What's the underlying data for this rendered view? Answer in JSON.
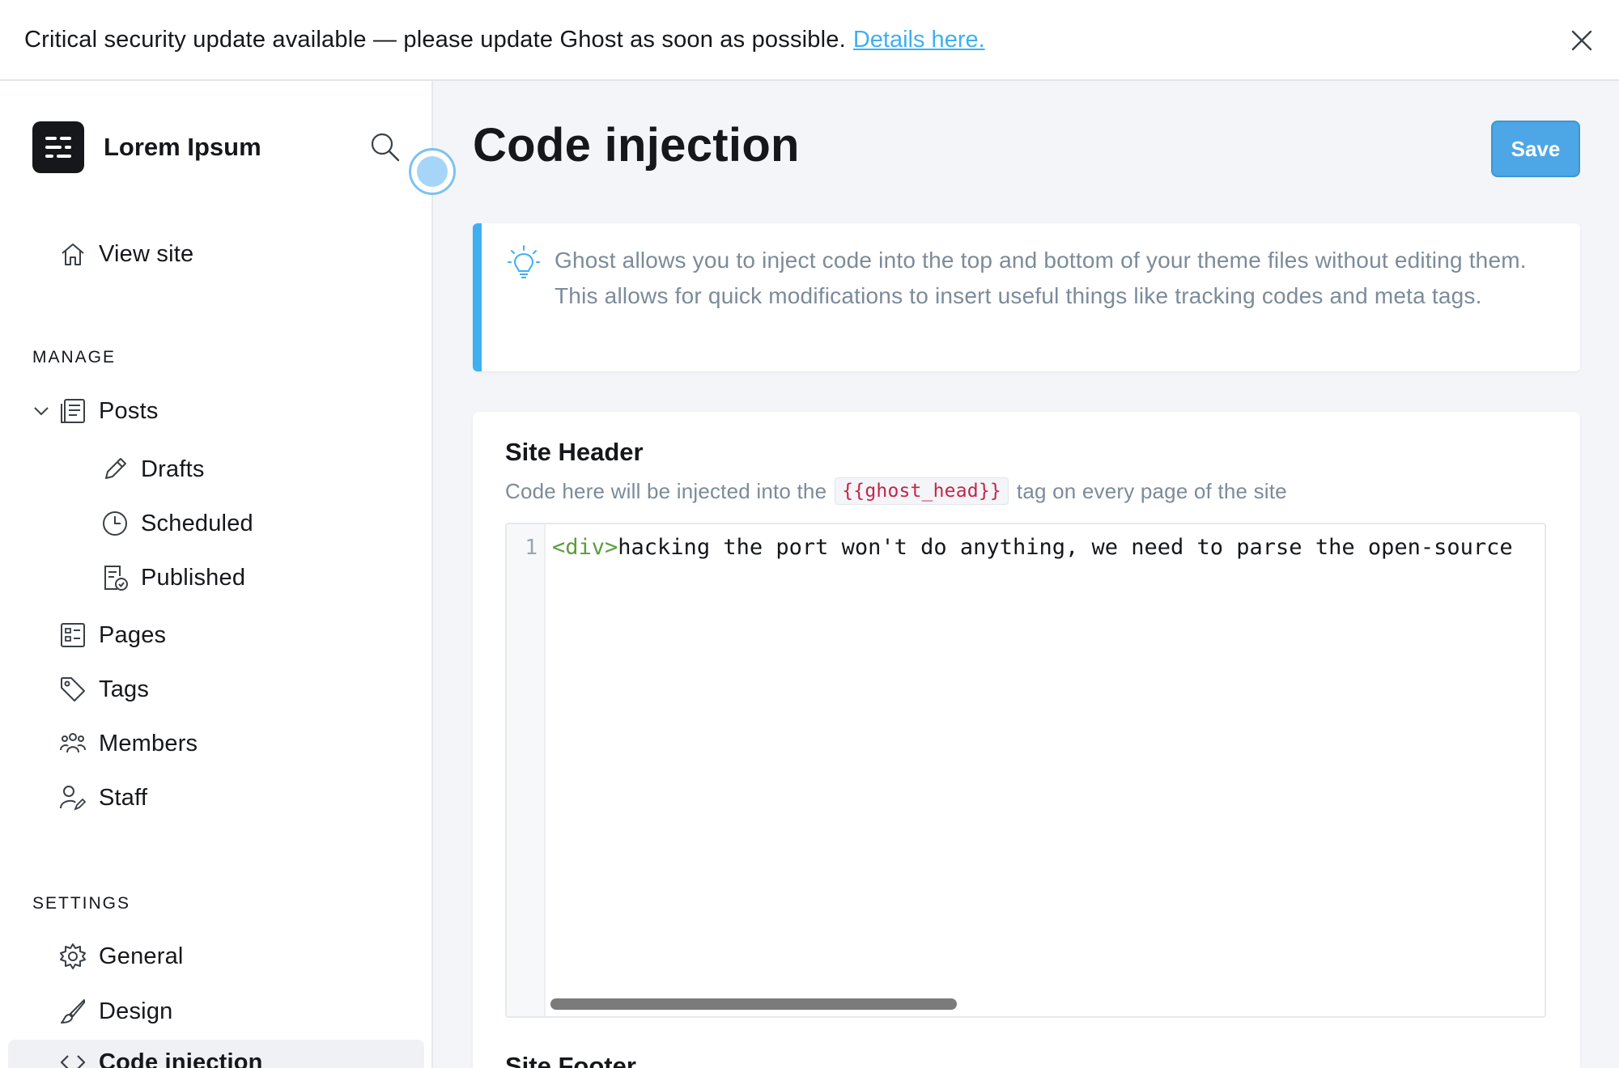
{
  "banner": {
    "message": "Critical security update available — please update Ghost as soon as possible.",
    "link_text": "Details here."
  },
  "sidebar": {
    "brand": "Lorem Ipsum",
    "view_site": "View site",
    "manage_label": "MANAGE",
    "manage_items": {
      "posts": "Posts",
      "drafts": "Drafts",
      "scheduled": "Scheduled",
      "published": "Published",
      "pages": "Pages",
      "tags": "Tags",
      "members": "Members",
      "staff": "Staff"
    },
    "settings_label": "SETTINGS",
    "settings_items": {
      "general": "General",
      "design": "Design",
      "code_injection": "Code injection"
    }
  },
  "main": {
    "title": "Code injection",
    "save_label": "Save",
    "info": "Ghost allows you to inject code into the top and bottom of your theme files without editing them. This allows for quick modifications to insert useful things like tracking codes and meta tags.",
    "site_header": {
      "title": "Site Header",
      "desc_before": "Code here will be injected into the",
      "tag": "{{ghost_head}}",
      "desc_after": "tag on every page of the site",
      "line_number": "1",
      "code_tag": "<div>",
      "code_text": "hacking the port won't do anything, we need to parse the open-source"
    },
    "site_footer": {
      "title": "Site Footer"
    }
  },
  "colors": {
    "accent": "#3eb0ef",
    "save_button": "#4da7e6",
    "code_tag_red": "#c5254a",
    "html_tag_green": "#5a9e3d"
  },
  "icons": [
    "close-icon",
    "search-icon",
    "home-icon",
    "chevron-down-icon",
    "posts-icon",
    "pencil-icon",
    "clock-icon",
    "published-icon",
    "pages-icon",
    "tag-icon",
    "members-icon",
    "staff-icon",
    "gear-icon",
    "brush-icon",
    "code-icon",
    "lightbulb-icon"
  ]
}
